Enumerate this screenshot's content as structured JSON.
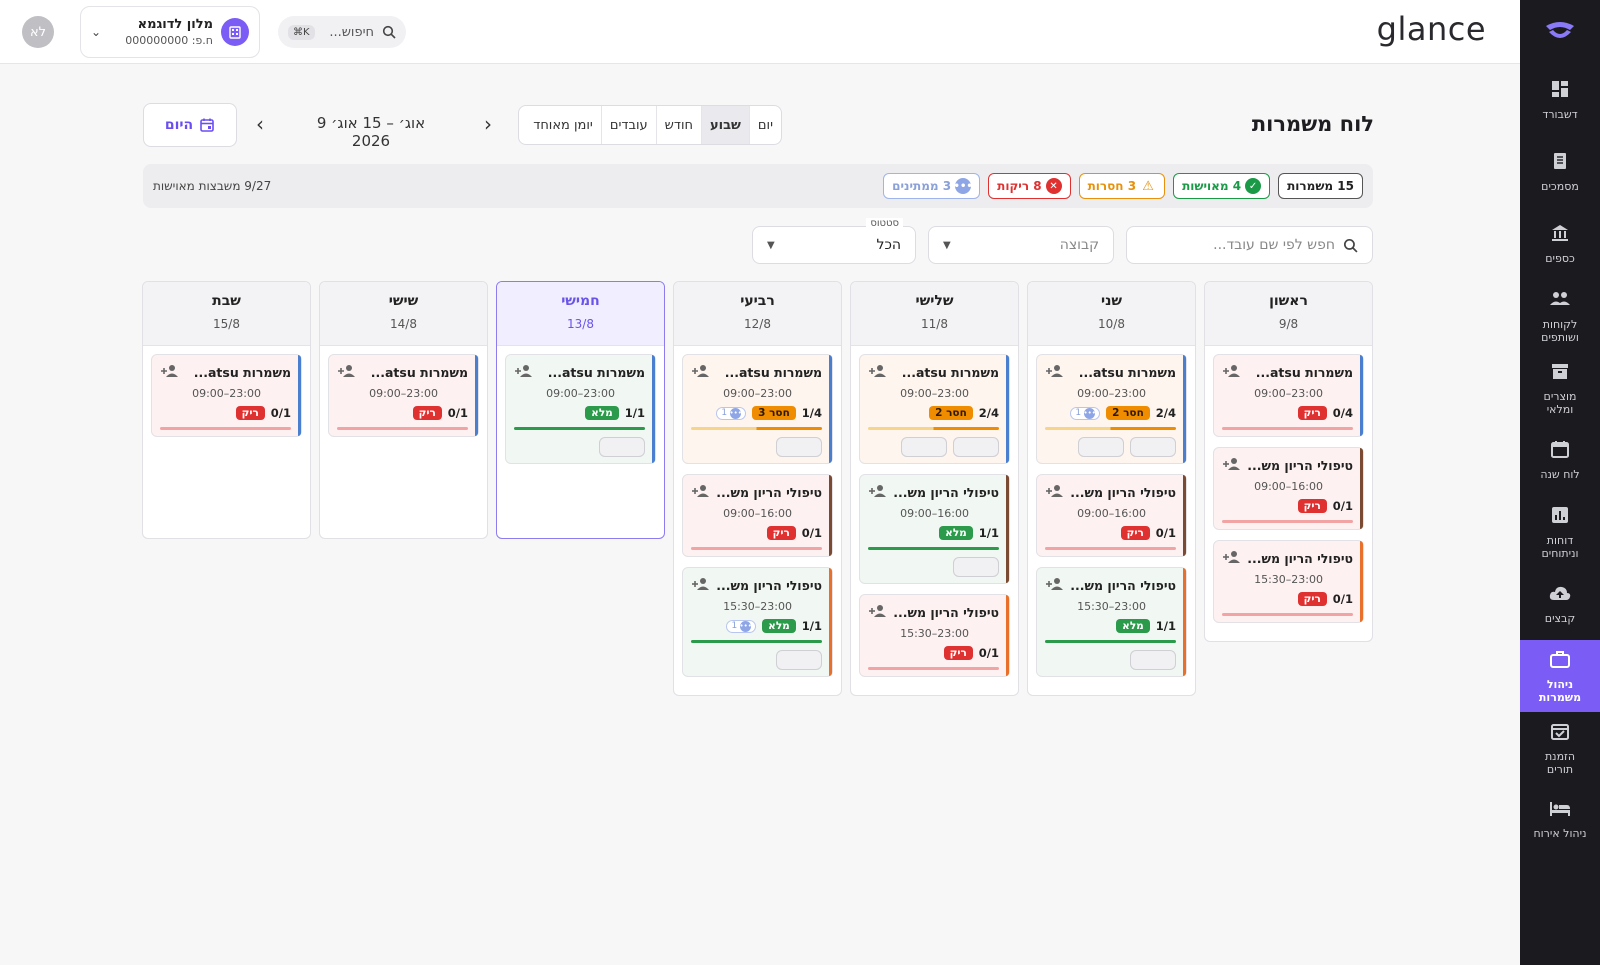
{
  "app": {
    "brand": "glance",
    "avatar_initials": "לא",
    "hotel_name": "מלון לדוגמא",
    "hotel_id": "ח.פ: 000000000",
    "search_placeholder": "חיפוש...",
    "search_shortcut": "K⌘"
  },
  "sidebar": [
    {
      "label": "דשבורד",
      "icon": "dashboard-icon"
    },
    {
      "label": "מסמכים",
      "icon": "documents-icon"
    },
    {
      "label": "כספים",
      "icon": "bank-icon"
    },
    {
      "label": "לקוחות\nושותפים",
      "icon": "people-icon"
    },
    {
      "label": "מוצרים\nומלאי",
      "icon": "archive-icon"
    },
    {
      "label": "לוח שנה",
      "icon": "calendar-icon"
    },
    {
      "label": "דוחות\nוניתוחים",
      "icon": "bar-chart-icon"
    },
    {
      "label": "קבצים",
      "icon": "cloud-upload-icon"
    },
    {
      "label": "ניהול\nמשמרות",
      "icon": "briefcase-icon",
      "active": true
    },
    {
      "label": "הזמנת\nתורים",
      "icon": "calendar-check-icon"
    },
    {
      "label": "ניהול אירוח",
      "icon": "bed-icon"
    }
  ],
  "page": {
    "title": "לוח משמרות",
    "view_tabs": [
      "יום",
      "שבוע",
      "חודש",
      "עובדים",
      "יומן מאוחד"
    ],
    "active_view": "שבוע",
    "date_range": "9 אוג׳ – 15 אוג׳ 2026",
    "today_label": "היום"
  },
  "stats": {
    "total": "15 משמרות",
    "staffed": "4 מאוישות",
    "short": "3 חסרות",
    "empty": "8 ריקות",
    "waiting": "3 ממתינים",
    "summary": "9/27 משבצות מאוישות"
  },
  "filters": {
    "search_placeholder": "חפש לפי שם עובד...",
    "group_placeholder": "קבוצה",
    "status_label": "סטטוס",
    "status_value": "הכל"
  },
  "colors": {
    "accent": "#7b5cf5",
    "empty": "#e03131",
    "short": "#f08c00",
    "full": "#2b9a4a",
    "waiting": "#8fa6e6",
    "type_atsu": "#4a7fd0",
    "type_turn": "#7a4b32",
    "type_evening": "#e8702a"
  },
  "days": [
    {
      "name": "ראשון",
      "date": "9/8",
      "shifts": [
        {
          "title": "משמרות atsu...",
          "time": "23:00–09:00",
          "count": "0/4",
          "status": "ריק",
          "state": "empty",
          "accent": "#4a7fd0",
          "waiting": "",
          "chips": 0
        },
        {
          "title": "טיפולי הריון מש...",
          "time": "16:00–09:00",
          "count": "0/1",
          "status": "ריק",
          "state": "empty",
          "accent": "#7a4b32",
          "waiting": "",
          "chips": 0
        },
        {
          "title": "טיפולי הריון מש...",
          "time": "23:00–15:30",
          "count": "0/1",
          "status": "ריק",
          "state": "empty",
          "accent": "#e8702a",
          "waiting": "",
          "chips": 0
        }
      ]
    },
    {
      "name": "שני",
      "date": "10/8",
      "shifts": [
        {
          "title": "משמרות atsu...",
          "time": "23:00–09:00",
          "count": "2/4",
          "status": "חסר 2",
          "state": "partial",
          "accent": "#4a7fd0",
          "waiting": "1",
          "chips": 2
        },
        {
          "title": "טיפולי הריון מש...",
          "time": "16:00–09:00",
          "count": "0/1",
          "status": "ריק",
          "state": "empty",
          "accent": "#7a4b32",
          "waiting": "",
          "chips": 0
        },
        {
          "title": "טיפולי הריון מש...",
          "time": "23:00–15:30",
          "count": "1/1",
          "status": "מלא",
          "state": "full",
          "accent": "#e8702a",
          "waiting": "",
          "chips": 1
        }
      ]
    },
    {
      "name": "שלישי",
      "date": "11/8",
      "shifts": [
        {
          "title": "משמרות atsu...",
          "time": "23:00–09:00",
          "count": "2/4",
          "status": "חסר 2",
          "state": "partial",
          "accent": "#4a7fd0",
          "waiting": "",
          "chips": 2
        },
        {
          "title": "טיפולי הריון מש...",
          "time": "16:00–09:00",
          "count": "1/1",
          "status": "מלא",
          "state": "full",
          "accent": "#7a4b32",
          "waiting": "",
          "chips": 1
        },
        {
          "title": "טיפולי הריון מש...",
          "time": "23:00–15:30",
          "count": "0/1",
          "status": "ריק",
          "state": "empty",
          "accent": "#e8702a",
          "waiting": "",
          "chips": 0
        }
      ]
    },
    {
      "name": "רביעי",
      "date": "12/8",
      "shifts": [
        {
          "title": "משמרות atsu...",
          "time": "23:00–09:00",
          "count": "1/4",
          "status": "חסר 3",
          "state": "partial",
          "accent": "#4a7fd0",
          "waiting": "1",
          "chips": 1
        },
        {
          "title": "טיפולי הריון מש...",
          "time": "16:00–09:00",
          "count": "0/1",
          "status": "ריק",
          "state": "empty",
          "accent": "#7a4b32",
          "waiting": "",
          "chips": 0
        },
        {
          "title": "טיפולי הריון מש...",
          "time": "23:00–15:30",
          "count": "1/1",
          "status": "מלא",
          "state": "full",
          "accent": "#e8702a",
          "waiting": "1",
          "chips": 1
        }
      ]
    },
    {
      "name": "חמישי",
      "date": "13/8",
      "today": true,
      "shifts": [
        {
          "title": "משמרות atsu...",
          "time": "23:00–09:00",
          "count": "1/1",
          "status": "מלא",
          "state": "full",
          "accent": "#4a7fd0",
          "waiting": "",
          "chips": 1
        }
      ]
    },
    {
      "name": "שישי",
      "date": "14/8",
      "shifts": [
        {
          "title": "משמרות atsu...",
          "time": "23:00–09:00",
          "count": "0/1",
          "status": "ריק",
          "state": "empty",
          "accent": "#4a7fd0",
          "waiting": "",
          "chips": 0
        }
      ]
    },
    {
      "name": "שבת",
      "date": "15/8",
      "shifts": [
        {
          "title": "משמרות atsu...",
          "time": "23:00–09:00",
          "count": "0/1",
          "status": "ריק",
          "state": "empty",
          "accent": "#4a7fd0",
          "waiting": "",
          "chips": 0
        }
      ]
    }
  ]
}
